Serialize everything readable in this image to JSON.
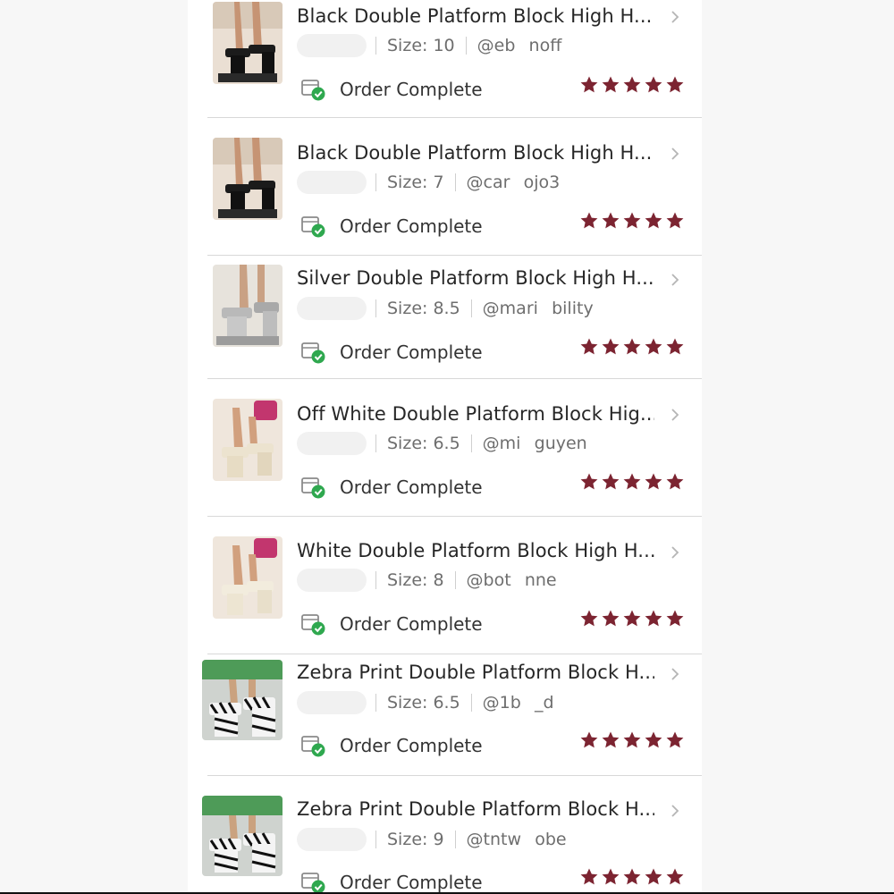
{
  "colors": {
    "star": "#7c2431",
    "check": "#2fa84f",
    "text": "#262626",
    "meta": "#6e6e6e"
  },
  "orders": [
    {
      "title": "Black Double Platform Block High H...",
      "size": "Size: 10",
      "username": "@eb    noff",
      "status": "Order Complete",
      "rating": 5,
      "image": "black-platform-heels"
    },
    {
      "title": "Black Double Platform Block High H...",
      "size": "Size: 7",
      "username": "@car    ojo3",
      "status": "Order Complete",
      "rating": 5,
      "image": "black-platform-heels"
    },
    {
      "title": "Silver Double Platform Block High H...",
      "size": "Size: 8.5",
      "username": "@mari    bility",
      "status": "Order Complete",
      "rating": 5,
      "image": "silver-platform-heels"
    },
    {
      "title": "Off White Double Platform Block Hig...",
      "size": "Size: 6.5",
      "username": "@mi    guyen",
      "status": "Order Complete",
      "rating": 5,
      "image": "offwhite-platform-heels"
    },
    {
      "title": "White Double Platform Block High H...",
      "size": "Size: 8",
      "username": "@bot    nne",
      "status": "Order Complete",
      "rating": 5,
      "image": "white-platform-heels"
    },
    {
      "title": "Zebra Print Double Platform Block H...",
      "size": "Size: 6.5",
      "username": "@1b    _d",
      "status": "Order Complete",
      "rating": 5,
      "image": "zebra-platform-heels"
    },
    {
      "title": "Zebra Print Double Platform Block H...",
      "size": "Size: 9",
      "username": "@tntw    obe",
      "status": "Order Complete",
      "rating": 5,
      "image": "zebra-platform-heels"
    }
  ]
}
